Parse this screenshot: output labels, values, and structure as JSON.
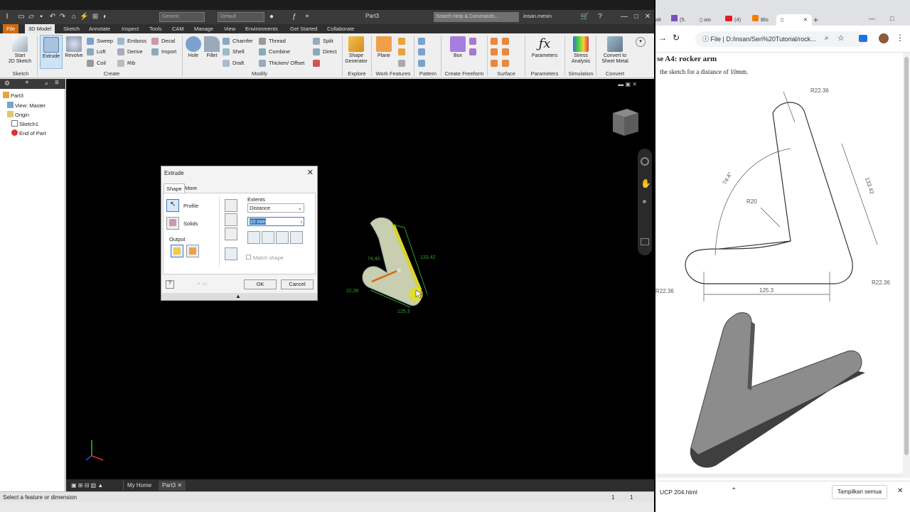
{
  "inventor": {
    "title": "Part3",
    "appearance_combo": "Generic",
    "material_combo": "Default",
    "search_placeholder": "Search Help & Commands...",
    "user": "insan.mesin",
    "tabs": [
      "File",
      "3D Model",
      "Sketch",
      "Annotate",
      "Inspect",
      "Tools",
      "CAM",
      "Manage",
      "View",
      "Environments",
      "Get Started",
      "Collaborate"
    ],
    "ribbon": {
      "start_2d_sketch": "Start\n2D Sketch",
      "extrude": "Extrude",
      "revolve": "Revolve",
      "sweep": "Sweep",
      "loft": "Loft",
      "coil": "Coil",
      "emboss": "Emboss",
      "derive": "Derive",
      "rib": "Rib",
      "decal": "Decal",
      "import": "Import",
      "hole": "Hole",
      "fillet": "Fillet",
      "chamfer": "Chamfer",
      "shell": "Shell",
      "draft": "Draft",
      "thread": "Thread",
      "combine": "Combine",
      "thicken": "Thicken/ Offset",
      "split": "Split",
      "direct": "Direct",
      "shape_generator": "Shape\nGenerator",
      "plane": "Plane",
      "box": "Box",
      "parameters": "Parameters",
      "stress_analysis": "Stress\nAnalysis",
      "convert_sheet_metal": "Convert to\nSheet Metal",
      "groups": [
        "Sketch",
        "Create",
        "Modify",
        "Explore",
        "Work Features",
        "Pattern",
        "Create Freeform",
        "Surface",
        "Parameters",
        "Simulation",
        "Convert"
      ]
    },
    "browser": {
      "items": [
        "Part3",
        "View: Master",
        "Origin",
        "Sketch1",
        "End of Part"
      ]
    },
    "dialog": {
      "title": "Extrude",
      "tabs": [
        "Shape",
        "More"
      ],
      "profile": "Profile",
      "solids": "Solids",
      "output": "Output",
      "extents": "Extents",
      "extents_value": "Distance",
      "distance_value": "10 mm",
      "match_shape": "Match shape",
      "ok": "OK",
      "cancel": "Cancel"
    },
    "viewport_dims": [
      "74,40",
      "133,42",
      "22,36",
      "125,3"
    ],
    "bottom_tabs": [
      "My Home",
      "Part3"
    ],
    "status": "Select a feature or dimension",
    "status_nums": [
      "1",
      "1"
    ]
  },
  "browser_chrome": {
    "tabs": [
      "alt",
      "(5.",
      "wo",
      "(4)",
      "Blo",
      ""
    ],
    "url": "D:/insan/Seri%20Tutorial/rock...",
    "url_prefix": "File",
    "heading": "se A4: rocker arm",
    "instruction": "the sketch for a distance of 10mm.",
    "dims": {
      "r1": "R22.36",
      "r2": "R20",
      "r3": "R22.36",
      "r4": "R22.36",
      "angle": "74.4°",
      "len": "133.42",
      "base": "125.3"
    },
    "download_file": "UCP 204.html",
    "show_all": "Tampilkan semua"
  }
}
